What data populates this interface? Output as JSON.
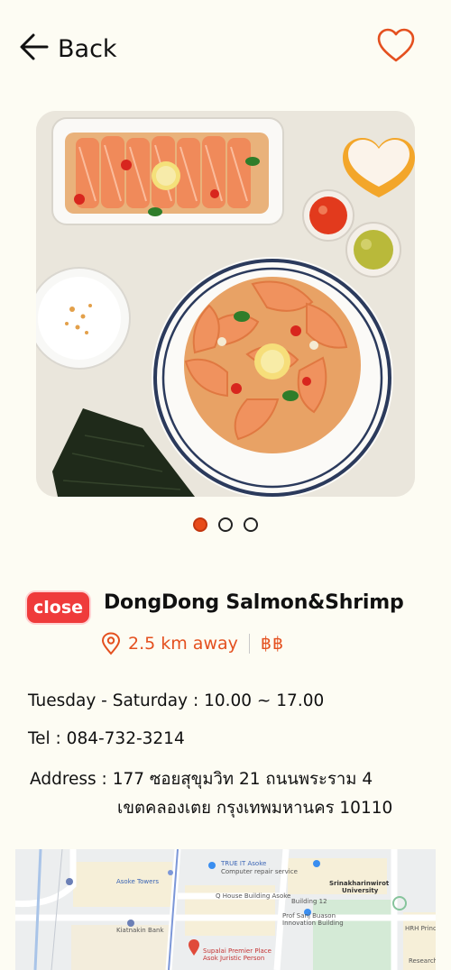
{
  "header": {
    "back_label": "Back",
    "back_icon": "arrow-left-icon",
    "favorite_icon": "heart-outline-icon"
  },
  "gallery": {
    "image_alt": "Salmon and shrimp dish photo",
    "pages": 3,
    "active_page": 1
  },
  "restaurant": {
    "status": "close",
    "name": "DongDong Salmon&Shrimp",
    "distance": "2.5 km away",
    "price_level": "฿฿",
    "hours": "Tuesday - Saturday : 10.00 ~ 17.00",
    "tel": "Tel : 084-732-3214",
    "address_label": "Address :",
    "address_line1": "177 ซอยสุขุมวิท 21 ถนนพระราม 4",
    "address_line2": "เขตคลองเตย กรุงเทพมหานคร 10110"
  },
  "map": {
    "labels": {
      "asoke_towers": "Asoke Towers",
      "trueit": "TRUE IT Asoke",
      "trueit_sub": "Computer repair service",
      "qhouse": "Q House Building Asoke",
      "building12": "Building 12",
      "prof_sanj": "Prof Sanj Buason",
      "prof_sanj_sub": "Innovation Building",
      "srinakharinwirot": "Srinakharinwirot",
      "university": "University",
      "kiatnakin": "Kiatnakin Bank",
      "supalai": "Supalai Premier Place",
      "supalai_sub": "Asok Juristic Person",
      "hrh": "HRH Princess",
      "research": "Research"
    }
  },
  "colors": {
    "accent": "#e4501f",
    "badge_red": "#ef3b3b",
    "background": "#fdfcf3"
  }
}
